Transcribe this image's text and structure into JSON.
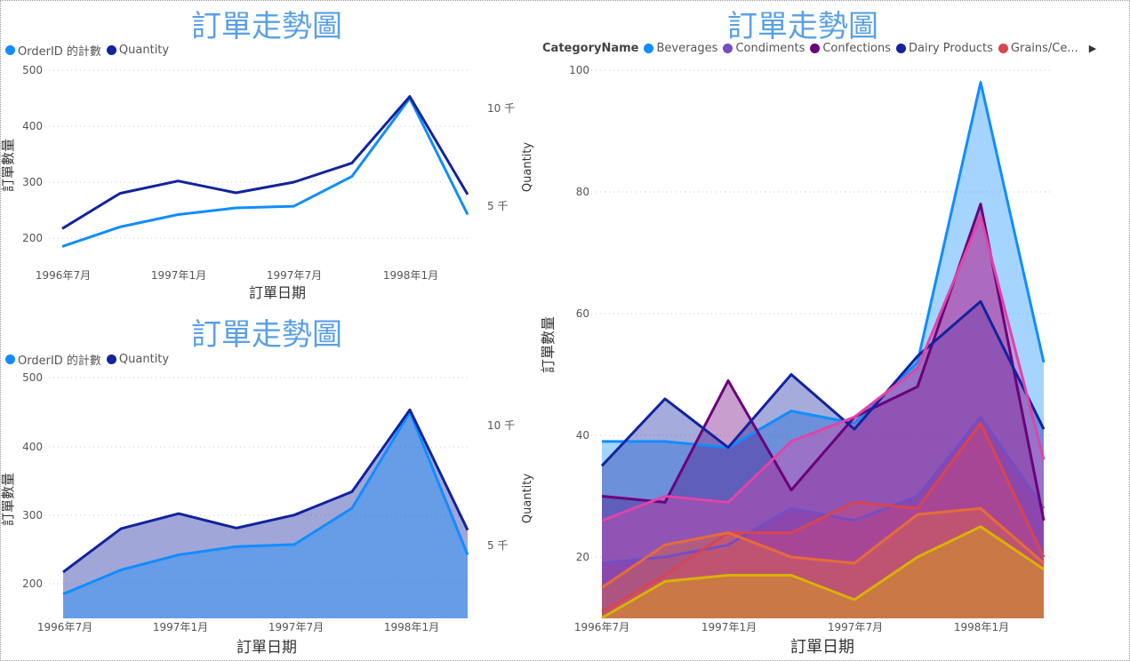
{
  "chart_data": [
    {
      "type": "line",
      "title": "訂單走勢圖",
      "xlabel": "訂單日期",
      "ylabel": "訂單數量",
      "y2label": "Quantity",
      "x": [
        "1996年7月",
        "1996年10月",
        "1997年1月",
        "1997年4月",
        "1997年7月",
        "1997年10月",
        "1998年1月",
        "1998年4月"
      ],
      "xticks": [
        "1996年7月",
        "1997年1月",
        "1997年7月",
        "1998年1月"
      ],
      "ylim": [
        150,
        500
      ],
      "yticks": [
        "200",
        "300",
        "400",
        "500"
      ],
      "y2ticks": [
        "5 千",
        "10 千"
      ],
      "grid": true,
      "legend_position": "top-left",
      "series": [
        {
          "name": "OrderID 的計數",
          "axis": "left",
          "color": "#118DFF",
          "values": [
            185,
            220,
            242,
            254,
            257,
            310,
            450,
            242
          ]
        },
        {
          "name": "Quantity",
          "axis": "right",
          "color": "#12239E",
          "values": [
            217,
            280,
            302,
            281,
            300,
            334,
            453,
            278
          ]
        }
      ]
    },
    {
      "type": "area",
      "title": "訂單走勢圖",
      "xlabel": "訂單日期",
      "ylabel": "訂單數量",
      "y2label": "Quantity",
      "x": [
        "1996年7月",
        "1996年10月",
        "1997年1月",
        "1997年4月",
        "1997年7月",
        "1997年10月",
        "1998年1月",
        "1998年4月"
      ],
      "xticks": [
        "1996年7月",
        "1997年1月",
        "1997年7月",
        "1998年1月"
      ],
      "ylim": [
        150,
        500
      ],
      "yticks": [
        "200",
        "300",
        "400",
        "500"
      ],
      "y2ticks": [
        "5 千",
        "10 千"
      ],
      "grid": true,
      "legend_position": "top-left",
      "series": [
        {
          "name": "OrderID 的計數",
          "axis": "left",
          "color": "#118DFF",
          "values": [
            185,
            220,
            242,
            254,
            257,
            310,
            450,
            242
          ]
        },
        {
          "name": "Quantity",
          "axis": "right",
          "color": "#12239E",
          "values": [
            217,
            280,
            302,
            281,
            300,
            334,
            453,
            278
          ]
        }
      ]
    },
    {
      "type": "area",
      "title": "訂單走勢圖",
      "xlabel": "訂單日期",
      "ylabel": "訂單數量",
      "legend_title": "CategoryName",
      "legend_position": "top-left",
      "x": [
        "1996年7月",
        "1996年10月",
        "1997年1月",
        "1997年4月",
        "1997年7月",
        "1997年10月",
        "1998年1月",
        "1998年4月"
      ],
      "xticks": [
        "1996年7月",
        "1997年1月",
        "1997年7月",
        "1998年1月"
      ],
      "ylim": [
        10,
        100
      ],
      "yticks": [
        "20",
        "40",
        "60",
        "80",
        "100"
      ],
      "grid": true,
      "series": [
        {
          "name": "Beverages",
          "color": "#118DFF",
          "values": [
            39,
            39,
            38,
            44,
            42,
            52,
            98,
            52
          ]
        },
        {
          "name": "Condiments",
          "color": "#744EC2",
          "values": [
            19,
            20,
            22,
            28,
            26,
            30,
            43,
            28
          ]
        },
        {
          "name": "Confections",
          "color": "#6B007B",
          "values": [
            30,
            29,
            49,
            31,
            43,
            48,
            78,
            26
          ]
        },
        {
          "name": "Dairy Products",
          "color": "#12239E",
          "values": [
            35,
            46,
            38,
            50,
            41,
            53,
            62,
            41
          ]
        },
        {
          "name": "Grains/Ce...",
          "color": "#D64550",
          "values": [
            11,
            17,
            24,
            24,
            29,
            28,
            42,
            20
          ]
        },
        {
          "name": "",
          "color": "#E044A7",
          "values": [
            26,
            30,
            29,
            39,
            43,
            51,
            76,
            36
          ]
        },
        {
          "name": "",
          "color": "#E66C37",
          "values": [
            15,
            22,
            24,
            20,
            19,
            27,
            28,
            19
          ]
        },
        {
          "name": "",
          "color": "#D9B300",
          "values": [
            10,
            16,
            17,
            17,
            13,
            20,
            25,
            18
          ]
        }
      ]
    }
  ]
}
